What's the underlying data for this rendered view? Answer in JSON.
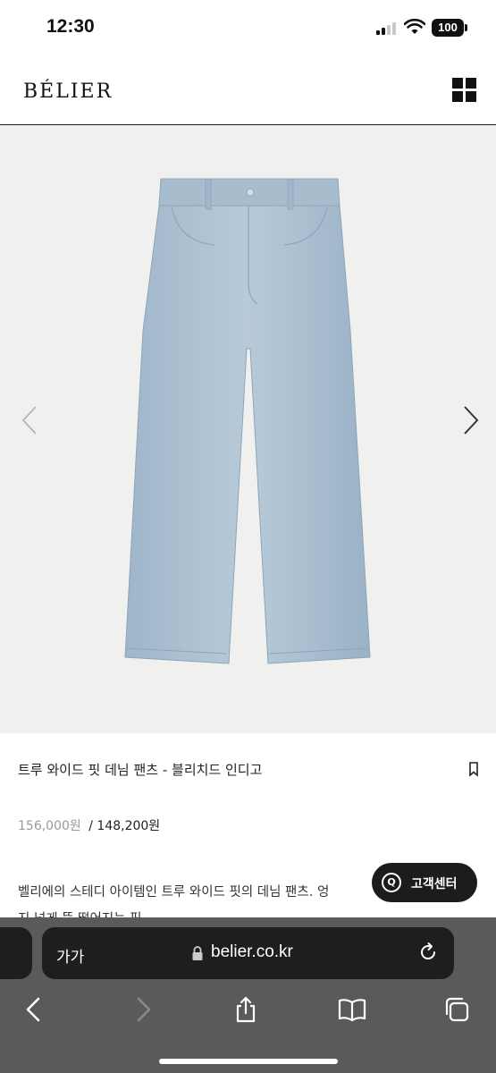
{
  "status_bar": {
    "time": "12:30",
    "battery": "100",
    "icons": [
      "signal-icon",
      "wifi-icon",
      "battery-icon"
    ]
  },
  "header": {
    "logo": "BÉLIER",
    "menu_icon": "grid-menu-icon"
  },
  "gallery": {
    "image": "light-blue wide-fit denim pants",
    "prev_icon": "chevron-left-icon",
    "next_icon": "chevron-right-icon"
  },
  "product": {
    "name": "트루 와이드 핏 데님 팬츠 - 블리치드 인디고",
    "bookmark_icon": "bookmark-icon",
    "price_original": "156,000원",
    "price_separator": "/",
    "price_sale": "148,200원",
    "description_line1": "벨리에의 스테디 아이템인 트루 와이드 핏의 데님 팬츠. 엉",
    "description_line2": "지 넉게 뚝 떨어지는 핏"
  },
  "customer_service": {
    "label": "고객센터",
    "icon_letter": "Q"
  },
  "browser": {
    "aa_label": "가가",
    "url": "belier.co.kr",
    "toolbar": [
      "back-icon",
      "forward-icon",
      "share-icon",
      "bookmarks-icon",
      "tabs-icon"
    ]
  },
  "colors": {
    "header_border": "#1a1a1a",
    "gallery_bg": "#f0f0ef",
    "denim": "#a9bfd1",
    "chrome_bg": "#5a5a5a",
    "address_bar_bg": "#1e1e1e"
  }
}
